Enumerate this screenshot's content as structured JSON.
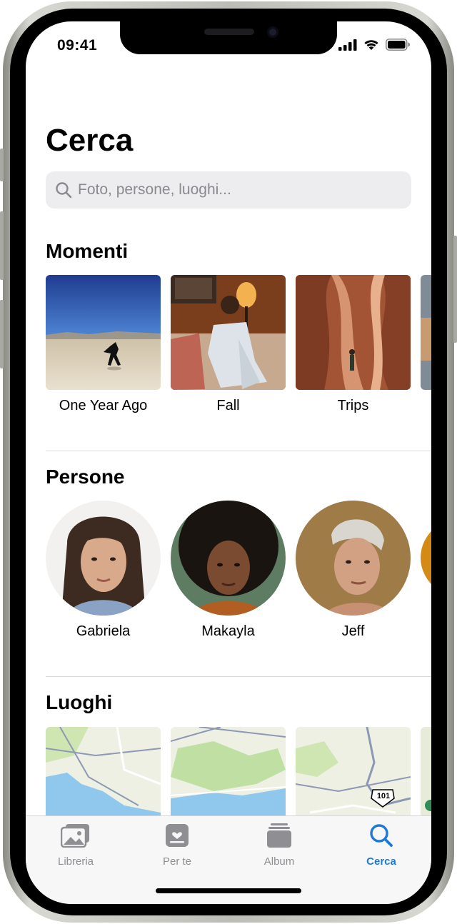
{
  "status": {
    "time": "09:41"
  },
  "header": {
    "title": "Cerca"
  },
  "search": {
    "placeholder": "Foto, persone, luoghi..."
  },
  "sections": {
    "moments": {
      "title": "Momenti",
      "items": [
        {
          "label": "One Year Ago"
        },
        {
          "label": "Fall"
        },
        {
          "label": "Trips"
        }
      ]
    },
    "people": {
      "title": "Persone",
      "items": [
        {
          "label": "Gabriela"
        },
        {
          "label": "Makayla"
        },
        {
          "label": "Jeff"
        }
      ]
    },
    "places": {
      "title": "Luoghi",
      "route_shield": "101"
    }
  },
  "tabbar": {
    "items": [
      {
        "label": "Libreria",
        "icon": "photo-library-icon"
      },
      {
        "label": "Per te",
        "icon": "for-you-icon"
      },
      {
        "label": "Album",
        "icon": "album-icon"
      },
      {
        "label": "Cerca",
        "icon": "search-icon"
      }
    ],
    "active_index": 3
  },
  "colors": {
    "accent": "#1e7ad4",
    "inactive": "#8e8e93"
  }
}
